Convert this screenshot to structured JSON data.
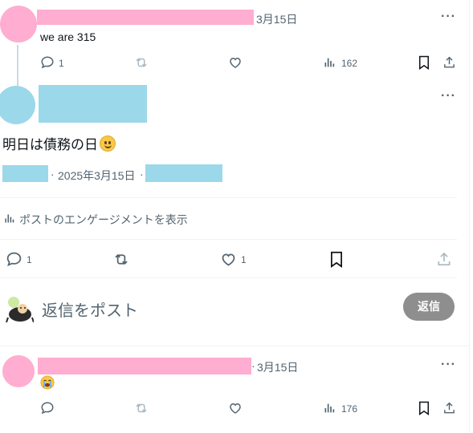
{
  "colors": {
    "redact_pink": "#ffadd0",
    "redact_blue": "#9bd8ea",
    "muted": "#536471",
    "divider": "#eff3f4",
    "reply_button_bg": "#8e8e8e"
  },
  "tweet1": {
    "date": "3月15日",
    "text": "we are 315",
    "replies": "1",
    "views": "162"
  },
  "main_tweet": {
    "text": "明日は債務の日",
    "emoji": "slightly-smiling-face",
    "date": "2025年3月15日",
    "separator": "·",
    "analytics_label": "ポストのエンゲージメントを表示",
    "replies": "1",
    "likes": "1"
  },
  "reply_box": {
    "placeholder": "返信をポスト",
    "button_label": "返信"
  },
  "tweet3": {
    "separator": "·",
    "date": "3月15日",
    "emoji": "loudly-crying-face",
    "views": "176"
  },
  "more_label": "···"
}
